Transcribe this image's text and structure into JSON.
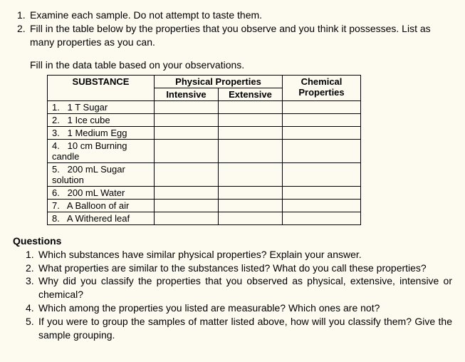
{
  "instructions": {
    "item1_num": "1.",
    "item1_text": "Examine each sample. Do not attempt to taste them.",
    "item2_num": "2.",
    "item2_text": "Fill in the table below by the properties that you observe and you think it possesses. List as many properties as you can.",
    "fill_text": "Fill in the data table based on your observations."
  },
  "table": {
    "header_substance": "SUBSTANCE",
    "header_physical": "Physical Properties",
    "header_intensive": "Intensive",
    "header_extensive": "Extensive",
    "header_chemical": "Chemical Properties",
    "rows": [
      {
        "num": "1.",
        "name": "1 T Sugar"
      },
      {
        "num": "2.",
        "name": "1 Ice cube"
      },
      {
        "num": "3.",
        "name": "1 Medium Egg"
      },
      {
        "num": "4.",
        "name": "10 cm Burning candle"
      },
      {
        "num": "5.",
        "name": "200 mL Sugar solution"
      },
      {
        "num": "6.",
        "name": "200 mL Water"
      },
      {
        "num": "7.",
        "name": "A Balloon of air"
      },
      {
        "num": "8.",
        "name": "A Withered leaf"
      }
    ]
  },
  "questions": {
    "heading": "Questions",
    "items": [
      {
        "num": "1.",
        "text": "Which substances have similar physical properties? Explain your answer."
      },
      {
        "num": "2.",
        "text": "What properties are similar to the substances listed? What do you call these properties?"
      },
      {
        "num": "3.",
        "text": "Why did you classify the properties that you observed as physical, extensive, intensive or chemical?"
      },
      {
        "num": "4.",
        "text": "Which among the properties you listed are measurable? Which ones are not?"
      },
      {
        "num": "5.",
        "text": "If you were to group the samples of matter listed above, how will you classify them? Give the sample grouping."
      }
    ]
  }
}
